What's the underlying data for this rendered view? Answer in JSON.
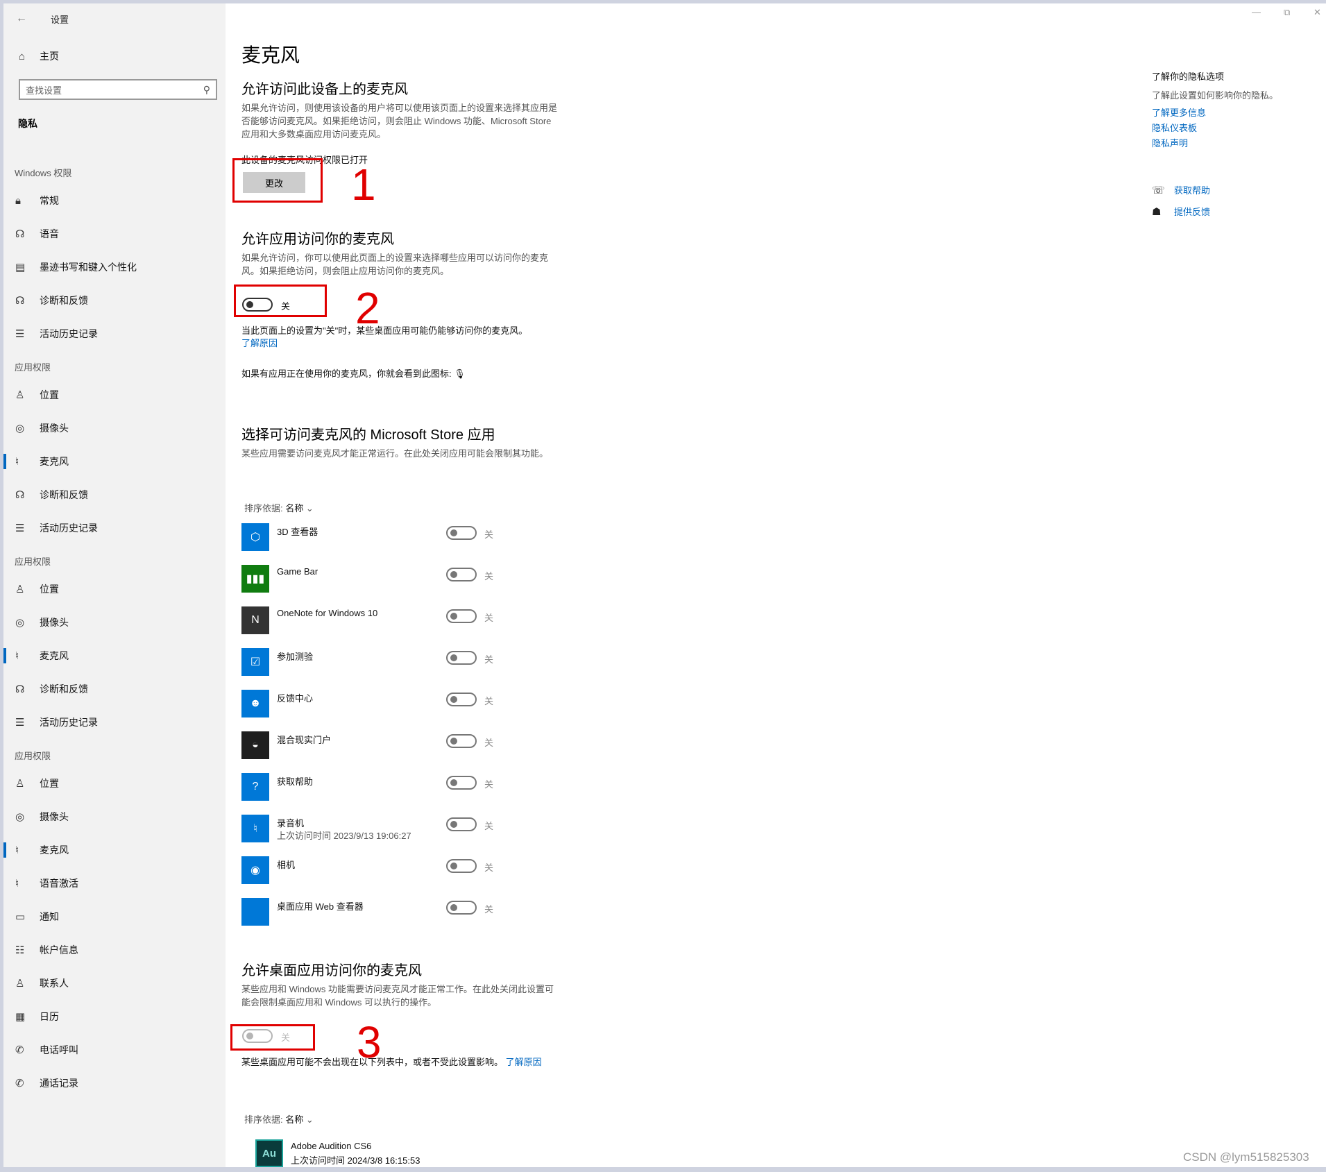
{
  "window": {
    "title": "设置",
    "back_icon": "back-arrow-icon",
    "minimize": "—",
    "maximize": "⧉",
    "close": "✕"
  },
  "sidebar": {
    "home": "主页",
    "search_placeholder": "查找设置",
    "current": "隐私",
    "groups": [
      {
        "title": "Windows 权限",
        "items": [
          {
            "icon": "lock-icon",
            "glyph": "🔒︎",
            "label": "常规"
          },
          {
            "icon": "speech-icon",
            "glyph": "☊",
            "label": "语音"
          },
          {
            "icon": "ink-icon",
            "glyph": "▤",
            "label": "墨迹书写和键入个性化"
          },
          {
            "icon": "feedback-icon",
            "glyph": "☊",
            "label": "诊断和反馈"
          },
          {
            "icon": "timeline-icon",
            "glyph": "☰",
            "label": "活动历史记录"
          }
        ]
      },
      {
        "title": "应用权限",
        "items": [
          {
            "icon": "location-icon",
            "glyph": "♙",
            "label": "位置"
          },
          {
            "icon": "camera-icon",
            "glyph": "◎",
            "label": "摄像头"
          },
          {
            "icon": "microphone-icon",
            "glyph": "♮",
            "label": "麦克风",
            "active": true
          },
          {
            "icon": "feedback-icon",
            "glyph": "☊",
            "label": "诊断和反馈"
          },
          {
            "icon": "timeline-icon",
            "glyph": "☰",
            "label": "活动历史记录"
          }
        ]
      },
      {
        "title": "应用权限",
        "items": [
          {
            "icon": "location-icon",
            "glyph": "♙",
            "label": "位置"
          },
          {
            "icon": "camera-icon",
            "glyph": "◎",
            "label": "摄像头"
          },
          {
            "icon": "microphone-icon",
            "glyph": "♮",
            "label": "麦克风",
            "active": true
          },
          {
            "icon": "feedback-icon",
            "glyph": "☊",
            "label": "诊断和反馈"
          },
          {
            "icon": "timeline-icon",
            "glyph": "☰",
            "label": "活动历史记录"
          }
        ]
      },
      {
        "title": "应用权限",
        "items": [
          {
            "icon": "location-icon",
            "glyph": "♙",
            "label": "位置"
          },
          {
            "icon": "camera-icon",
            "glyph": "◎",
            "label": "摄像头"
          },
          {
            "icon": "microphone-icon",
            "glyph": "♮",
            "label": "麦克风",
            "active": true
          },
          {
            "icon": "voice-activation-icon",
            "glyph": "♮",
            "label": "语音激活"
          },
          {
            "icon": "notification-icon",
            "glyph": "▭",
            "label": "通知"
          },
          {
            "icon": "account-info-icon",
            "glyph": "☷",
            "label": "帐户信息"
          },
          {
            "icon": "contacts-icon",
            "glyph": "♙",
            "label": "联系人"
          },
          {
            "icon": "calendar-icon",
            "glyph": "▦",
            "label": "日历"
          },
          {
            "icon": "phone-icon",
            "glyph": "✆",
            "label": "电话呼叫"
          },
          {
            "icon": "call-history-icon",
            "glyph": "✆",
            "label": "通话记录"
          }
        ]
      }
    ]
  },
  "main": {
    "title": "麦克风",
    "device": {
      "heading": "允许访问此设备上的麦克风",
      "desc": "如果允许访问，则使用该设备的用户将可以使用该页面上的设置来选择其应用是否能够访问麦克风。如果拒绝访问，则会阻止 Windows 功能、Microsoft Store 应用和大多数桌面应用访问麦克风。",
      "status": "此设备的麦克风访问权限已打开",
      "button": "更改"
    },
    "apps_access": {
      "heading": "允许应用访问你的麦克风",
      "desc": "如果允许访问，你可以使用此页面上的设置来选择哪些应用可以访问你的麦克风。如果拒绝访问，则会阻止应用访问你的麦克风。",
      "toggle_label": "关",
      "note": "当此页面上的设置为\"关\"时，某些桌面应用可能仍能够访问你的麦克风。",
      "note_link": "了解原因",
      "indicator_text": "如果有应用正在使用你的麦克风，你就会看到此图标:"
    },
    "store_apps": {
      "heading": "选择可访问麦克风的 Microsoft Store 应用",
      "desc": "某些应用需要访问麦克风才能正常运行。在此处关闭应用可能会限制其功能。",
      "sort_label": "排序依据:",
      "sort_value": "名称",
      "apps": [
        {
          "name": "3D 查看器",
          "sub": "",
          "toggle": "关",
          "icon": "3d-viewer-icon",
          "glyph": "⬡",
          "color": "#0078d7"
        },
        {
          "name": "Game Bar",
          "sub": "",
          "toggle": "关",
          "icon": "game-bar-icon",
          "glyph": "▮▮▮",
          "color": "#107c10"
        },
        {
          "name": "OneNote for Windows 10",
          "sub": "",
          "toggle": "关",
          "icon": "onenote-icon",
          "glyph": "N",
          "color": "#333333"
        },
        {
          "name": "参加测验",
          "sub": "",
          "toggle": "关",
          "icon": "take-a-test-icon",
          "glyph": "☑",
          "color": "#0078d7"
        },
        {
          "name": "反馈中心",
          "sub": "",
          "toggle": "关",
          "icon": "feedback-hub-icon",
          "glyph": "☻",
          "color": "#0078d7"
        },
        {
          "name": "混合现实门户",
          "sub": "",
          "toggle": "关",
          "icon": "mixed-reality-icon",
          "glyph": "◒",
          "color": "#1f1f1f"
        },
        {
          "name": "获取帮助",
          "sub": "",
          "toggle": "关",
          "icon": "get-help-icon",
          "glyph": "?",
          "color": "#0078d7"
        },
        {
          "name": "录音机",
          "sub": "上次访问时间 2023/9/13 19:06:27",
          "toggle": "关",
          "icon": "voice-recorder-icon",
          "glyph": "♮",
          "color": "#0078d7"
        },
        {
          "name": "相机",
          "sub": "",
          "toggle": "关",
          "icon": "camera-app-icon",
          "glyph": "◉",
          "color": "#0078d7"
        },
        {
          "name": "桌面应用 Web 查看器",
          "sub": "",
          "toggle": "关",
          "icon": "web-viewer-icon",
          "glyph": "",
          "color": "#0078d7"
        }
      ]
    },
    "desktop_apps": {
      "heading": "允许桌面应用访问你的麦克风",
      "desc": "某些应用和 Windows 功能需要访问麦克风才能正常工作。在此处关闭此设置可能会限制桌面应用和 Windows 可以执行的操作。",
      "toggle_label": "关",
      "note": "某些桌面应用可能不会出现在以下列表中，或者不受此设置影响。",
      "note_link": "了解原因",
      "sort_label": "排序依据:",
      "sort_value": "名称",
      "app": {
        "name": "Adobe Audition CS6",
        "sub": "上次访问时间 2024/3/8 16:15:53",
        "badge": "Au"
      }
    },
    "annotations": [
      "1",
      "2",
      "3"
    ]
  },
  "right_panel": {
    "heading": "了解你的隐私选项",
    "desc": "了解此设置如何影响你的隐私。",
    "links": [
      "了解更多信息",
      "隐私仪表板",
      "隐私声明"
    ],
    "help": "获取帮助",
    "feedback": "提供反馈"
  },
  "watermark": "CSDN @lym515825303"
}
